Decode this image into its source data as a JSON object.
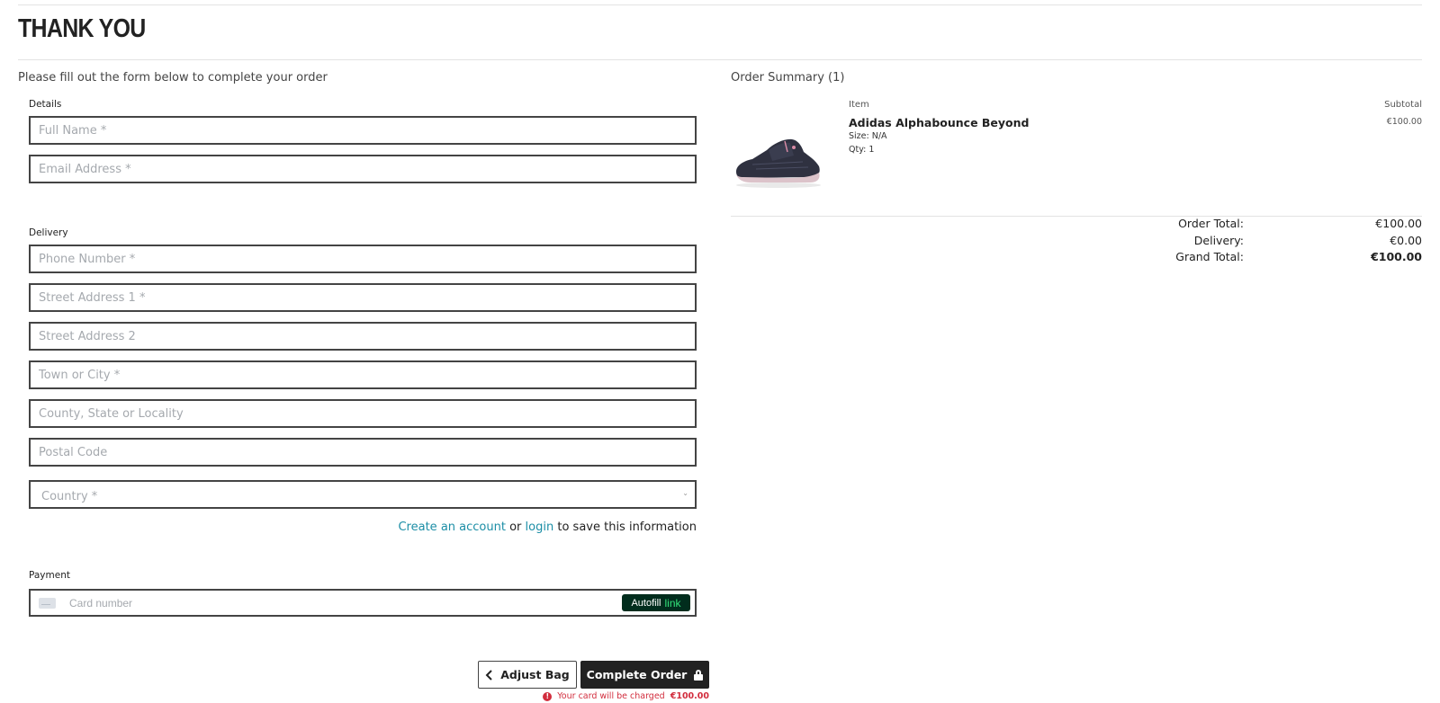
{
  "page": {
    "title": "THANK YOU",
    "form_intro": "Please fill out the form below to complete your order"
  },
  "details": {
    "label": "Details",
    "full_name_placeholder": "Full Name *",
    "email_placeholder": "Email Address *"
  },
  "delivery": {
    "label": "Delivery",
    "phone_placeholder": "Phone Number *",
    "street1_placeholder": "Street Address 1 *",
    "street2_placeholder": "Street Address 2",
    "town_placeholder": "Town or City *",
    "county_placeholder": "County, State or Locality",
    "postal_placeholder": "Postal Code",
    "country_placeholder": "Country *"
  },
  "save_info": {
    "create_account": "Create an account",
    "or": "or",
    "login": "login",
    "suffix": "to save this information"
  },
  "payment": {
    "label": "Payment",
    "card_placeholder": "Card number",
    "autofill_text": "Autofill",
    "autofill_link": "link",
    "autofill_bg": "#012d1d",
    "autofill_link_color": "#33e07a"
  },
  "actions": {
    "adjust_bag": "Adjust Bag",
    "complete_order": "Complete Order",
    "charge_note": "Your card will be charged",
    "charge_amount": "€100.00",
    "warning_color": "#d22d3d"
  },
  "summary": {
    "title": "Order Summary (1)",
    "col_item": "Item",
    "col_subtotal": "Subtotal",
    "items": [
      {
        "name": "Adidas Alphabounce Beyond",
        "size": "Size: N/A",
        "qty": "Qty: 1",
        "subtotal": "€100.00",
        "image": "sneaker-image"
      }
    ],
    "order_total_label": "Order Total:",
    "order_total": "€100.00",
    "delivery_label": "Delivery:",
    "delivery_cost": "€0.00",
    "grand_total_label": "Grand Total:",
    "grand_total": "€100.00"
  },
  "colors": {
    "link": "#1c8ea6",
    "primary_button": "#222222"
  }
}
